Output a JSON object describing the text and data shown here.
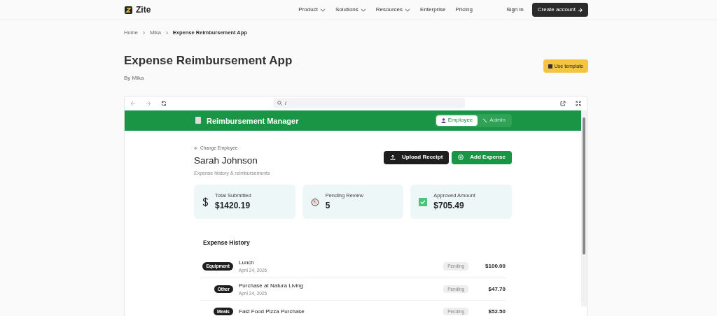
{
  "nav": {
    "logo": "Zite",
    "links": [
      {
        "label": "Product",
        "dropdown": true
      },
      {
        "label": "Solutions",
        "dropdown": true
      },
      {
        "label": "Resources",
        "dropdown": true
      },
      {
        "label": "Enterprise",
        "dropdown": false
      },
      {
        "label": "Pricing",
        "dropdown": false
      }
    ],
    "sign_in": "Sign in",
    "create_account": "Create account"
  },
  "breadcrumb": [
    "Home",
    "Mika",
    "Expense Reimbursement App"
  ],
  "title": "Expense Reimbursement App",
  "author": "By Mika",
  "use_template": "Use template",
  "browser": {
    "url": "/"
  },
  "app": {
    "title": "Reimbursement Manager",
    "tabs": [
      {
        "label": "Employee",
        "selected": true
      },
      {
        "label": "Admin",
        "selected": false
      }
    ],
    "back": "Change Employee",
    "employee": "Sarah Johnson",
    "subtitle": "Expense history & reimbursements",
    "buttons": [
      {
        "label": "Upload Receipt",
        "kind": "upload"
      },
      {
        "label": "Add Expense",
        "kind": "add"
      }
    ],
    "stats": [
      {
        "kind": "dollar",
        "label": "Total Submitted",
        "value": "$1420.19"
      },
      {
        "kind": "clock",
        "label": "Pending Review",
        "value": "5"
      },
      {
        "kind": "check",
        "label": "Approved Amount",
        "value": "$705.49"
      }
    ],
    "history_title": "Expense History",
    "expenses": [
      {
        "category": "Equipment",
        "title": "Lunch",
        "date": "April 24, 2026",
        "status": "Pending",
        "amount": "$100.00"
      },
      {
        "category": "Other",
        "title": "Purchase at Natura Living",
        "date": "April 24, 2025",
        "status": "Pending",
        "amount": "$47.70"
      },
      {
        "category": "Meals",
        "title": "Fast Food Pizza Purchase",
        "status": "Pending",
        "amount": "$52.50"
      }
    ]
  }
}
